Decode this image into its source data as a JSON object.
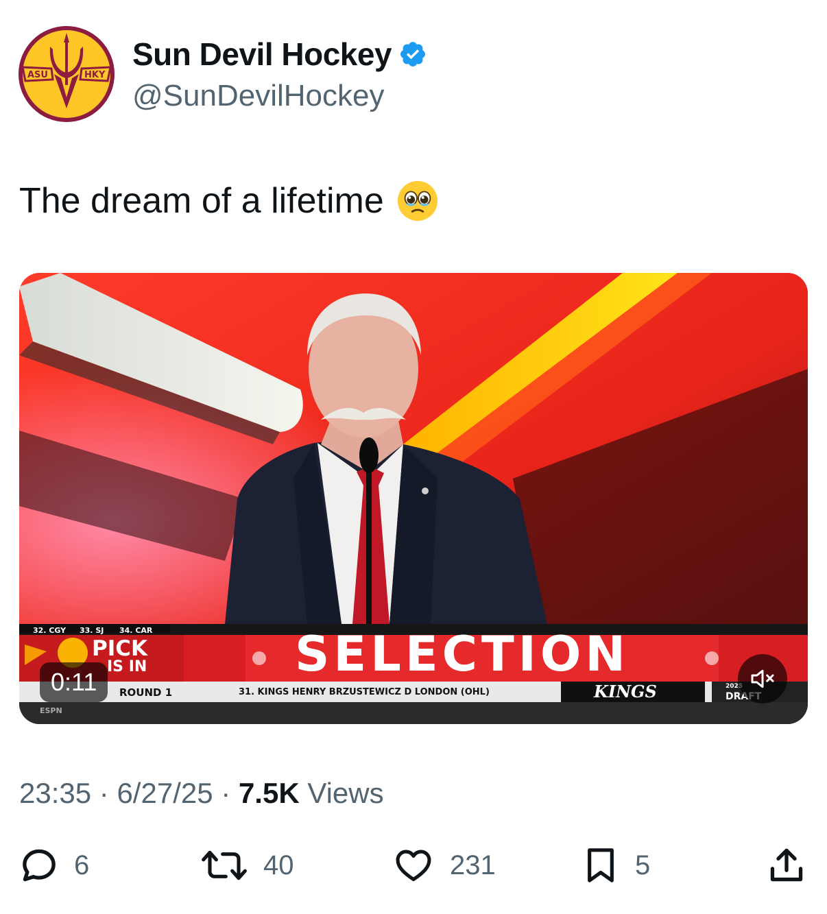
{
  "account": {
    "display_name": "Sun Devil Hockey",
    "handle": "@SunDevilHockey",
    "verified": true,
    "avatar_text_left": "ASU",
    "avatar_text_right": "HKY"
  },
  "tweet": {
    "text": "The dream of a lifetime",
    "emoji": "face-holding-back-tears"
  },
  "video": {
    "duration": "0:11",
    "muted": true,
    "broadcast": {
      "order_1": "32. CGY",
      "order_2": "33. SJ",
      "order_3": "34. CAR",
      "pick_line1": "PICK",
      "pick_line2": "IS IN",
      "banner": "SELECTION",
      "round": "ROUND 1",
      "pick_info": "31. KINGS  HENRY BRZUSTEWICZ  D  LONDON (OHL)",
      "team_logo": "KINGS",
      "network": "ESPN",
      "event_line1": "2025",
      "event_line2": "DRAFT"
    }
  },
  "meta": {
    "time": "23:35",
    "date": "6/27/25",
    "views_count": "7.5K",
    "views_label": "Views",
    "separator": "·"
  },
  "actions": {
    "replies": "6",
    "reposts": "40",
    "likes": "231",
    "bookmarks": "5"
  },
  "colors": {
    "asu_maroon": "#8c1d40",
    "asu_gold": "#ffc627",
    "verified_blue": "#1d9bf0",
    "muted_text": "#536471",
    "flames_red": "#d8261c"
  }
}
